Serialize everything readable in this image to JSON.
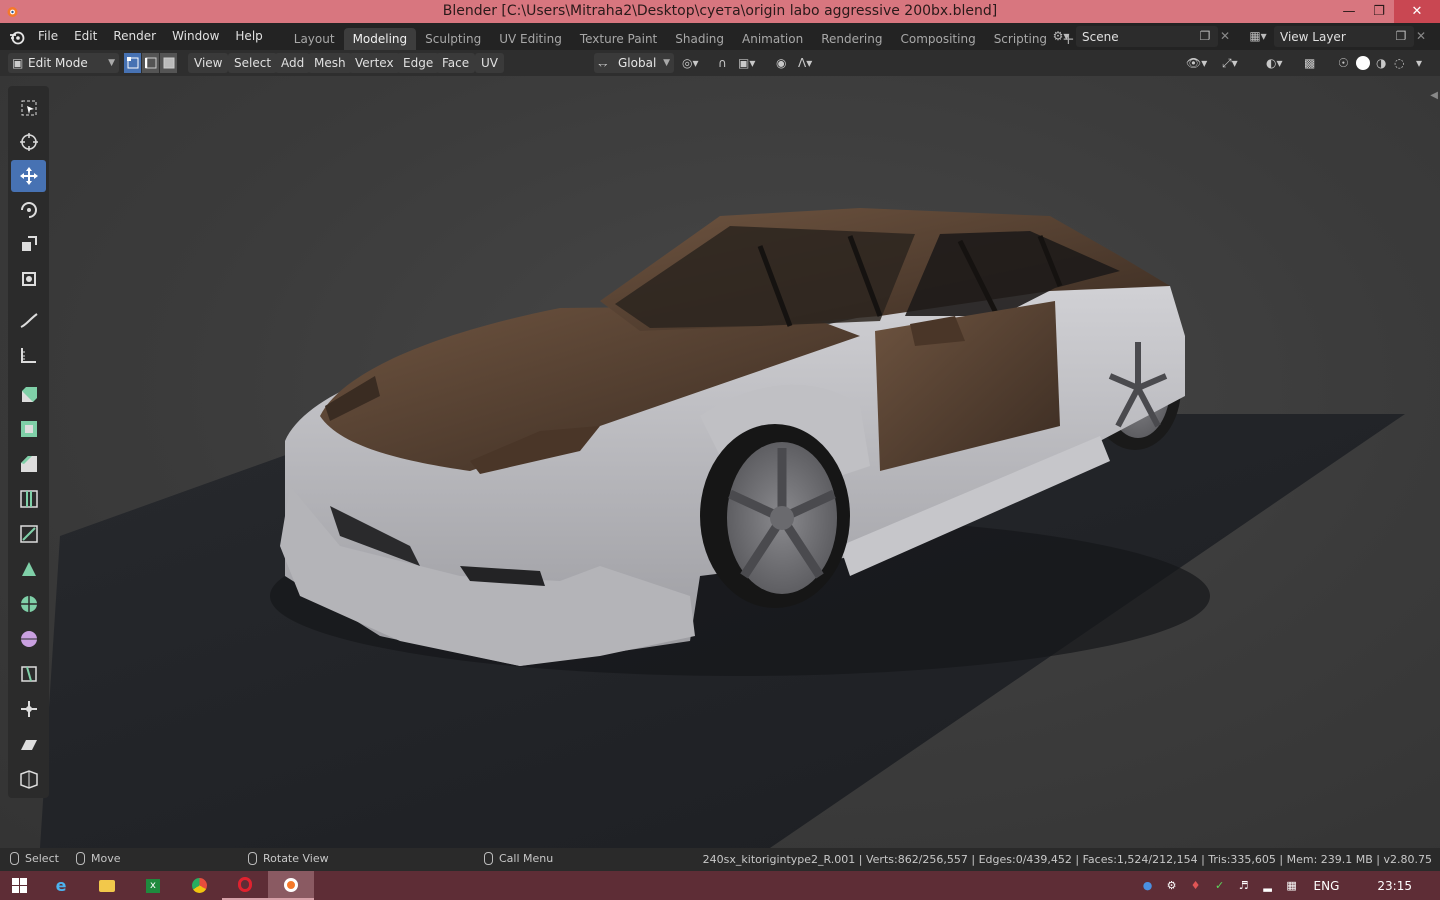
{
  "window": {
    "title": "Blender [C:\\Users\\Mitraha2\\Desktop\\суета\\origin labo aggressive 200bx.blend]",
    "min_icon": "minimize-icon",
    "max_icon": "restore-icon",
    "close_icon": "close-icon"
  },
  "menu": [
    "File",
    "Edit",
    "Render",
    "Window",
    "Help"
  ],
  "workspaces": {
    "tabs": [
      "Layout",
      "Modeling",
      "Sculpting",
      "UV Editing",
      "Texture Paint",
      "Shading",
      "Animation",
      "Rendering",
      "Compositing",
      "Scripting"
    ],
    "active": "Modeling",
    "add_label": "+"
  },
  "scene": {
    "name": "Scene",
    "view_layer": "View Layer"
  },
  "viewport_header": {
    "mode": "Edit Mode",
    "menus": [
      "View",
      "Select",
      "Add",
      "Mesh",
      "Vertex",
      "Edge",
      "Face",
      "UV"
    ],
    "orientation": "Global"
  },
  "toolbar": {
    "tools": [
      "select-box-icon",
      "cursor-icon",
      "move-icon",
      "rotate-icon",
      "scale-icon",
      "transform-icon",
      "annotate-icon",
      "measure-icon",
      "extrude-icon",
      "inset-icon",
      "bevel-icon",
      "loop-cut-icon",
      "knife-icon",
      "poly-build-icon",
      "spin-icon",
      "smooth-icon",
      "edge-slide-icon",
      "shrink-fatten-icon",
      "shear-icon",
      "rip-region-icon"
    ],
    "active_index": 2
  },
  "statusbar": {
    "select": "Select",
    "move": "Move",
    "rotate": "Rotate View",
    "call_menu": "Call Menu",
    "stats": "240sx_kitorigintype2_R.001 | Verts:862/256,557 | Edges:0/439,452 | Faces:1,524/212,154 | Tris:335,605 | Mem: 239.1 MB | v2.80.75"
  },
  "taskbar": {
    "apps": [
      "ie-icon",
      "explorer-icon",
      "excel-icon",
      "chrome-icon",
      "opera-icon",
      "blender-icon"
    ],
    "language": "ENG",
    "time": "23:15"
  },
  "colors": {
    "accent": "#4772b3",
    "titlebar": "#d8767f",
    "taskbar": "#5e2d36",
    "car_body": "#b7b8bd",
    "car_primer": "#5a4333"
  }
}
